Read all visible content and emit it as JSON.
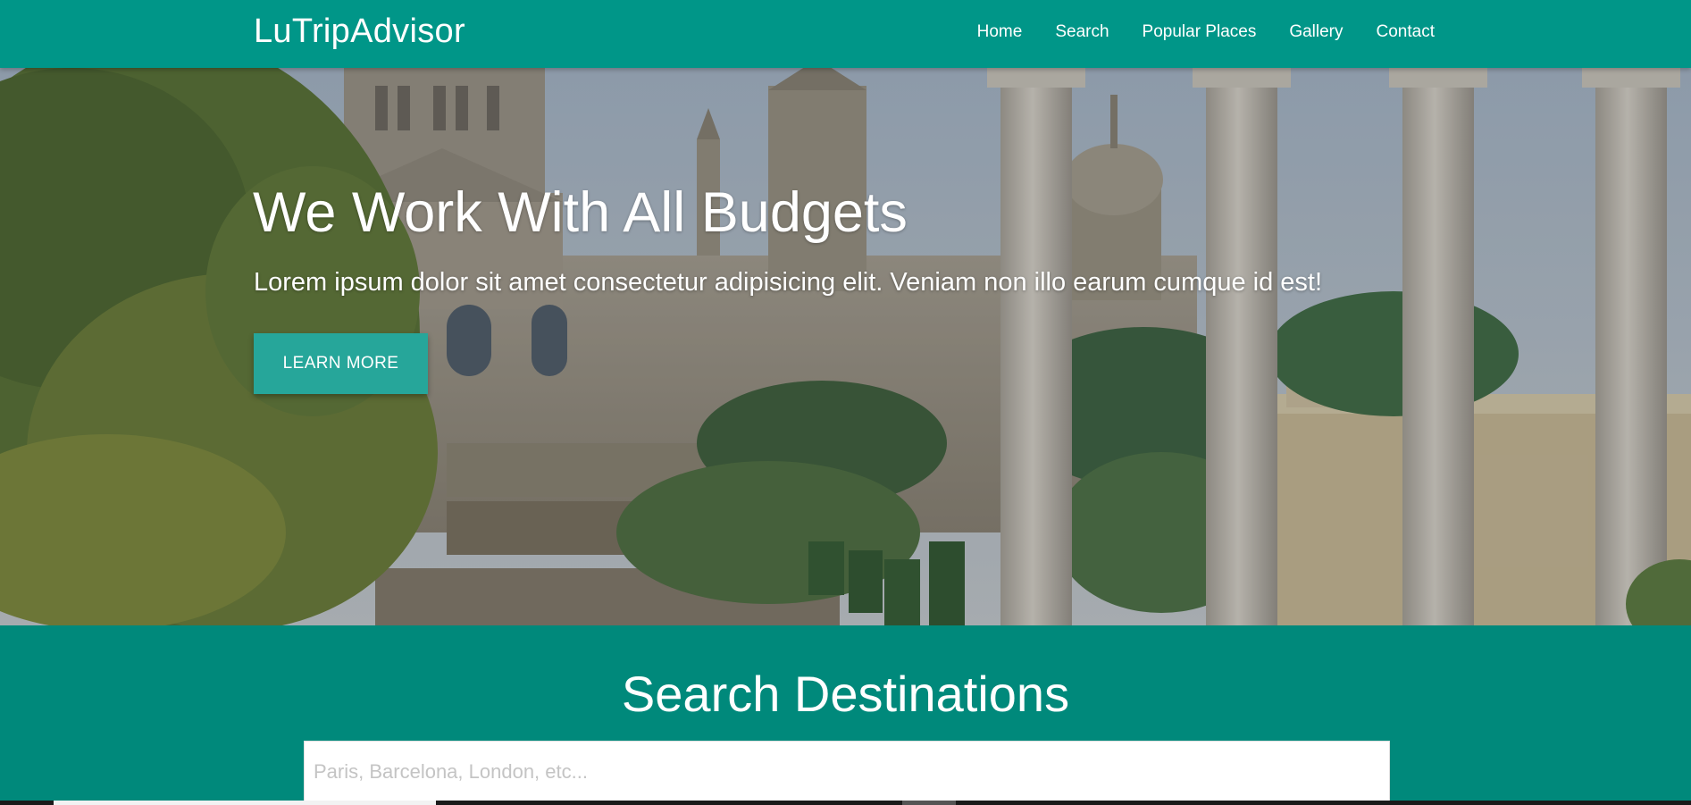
{
  "navbar": {
    "brand": "LuTripAdvisor",
    "links": [
      "Home",
      "Search",
      "Popular Places",
      "Gallery",
      "Contact"
    ],
    "color": "#009688"
  },
  "hero": {
    "title": "We Work With All Budgets",
    "text": "Lorem ipsum dolor sit amet consectetur adipisicing elit. Veniam non illo earum cumque id est!",
    "button_label": "LEARN MORE",
    "button_color": "#26a69a"
  },
  "search": {
    "heading": "Search Destinations",
    "placeholder": "Paris, Barcelona, London, etc...",
    "value": "",
    "section_color": "#00897b"
  }
}
